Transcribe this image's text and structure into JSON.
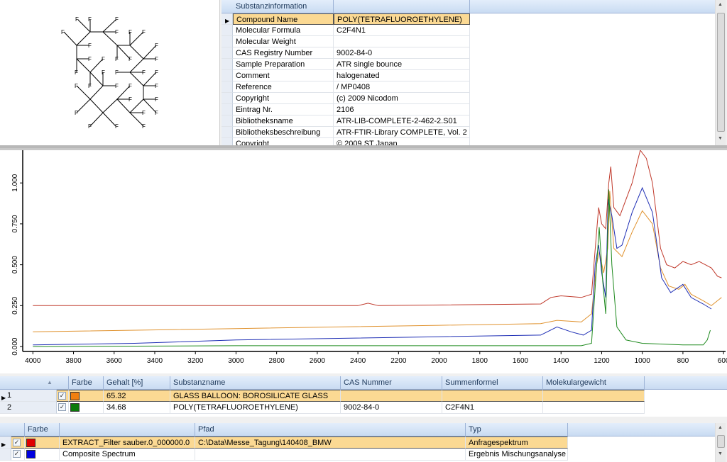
{
  "substance_info": {
    "header": "Substanzinformation",
    "rows": [
      {
        "label": "Compound Name",
        "value": "POLY(TETRAFLUOROETHYLENE)"
      },
      {
        "label": "Molecular Formula",
        "value": "C2F4N1"
      },
      {
        "label": "Molecular Weight",
        "value": ""
      },
      {
        "label": "CAS Registry Number",
        "value": "9002-84-0"
      },
      {
        "label": "Sample Preparation",
        "value": "ATR single bounce"
      },
      {
        "label": "Comment",
        "value": "halogenated"
      },
      {
        "label": "Reference",
        "value": "/ MP0408"
      },
      {
        "label": "Copyright",
        "value": "(c) 2009 Nicodom"
      },
      {
        "label": "Eintrag Nr.",
        "value": "2106"
      },
      {
        "label": "Bibliotheksname",
        "value": "ATR-LIB-COMPLETE-2-462-2.S01"
      },
      {
        "label": "Bibliotheksbeschreibung",
        "value": "ATR-FTIR-Library COMPLETE, Vol. 2"
      },
      {
        "label": "Copyright",
        "value": "© 2009 ST Japan"
      }
    ]
  },
  "molecule": {
    "atom_label": "F"
  },
  "chart_data": {
    "type": "line",
    "xlim": [
      4050,
      590
    ],
    "ylim": [
      -0.03,
      1.2
    ],
    "x_ticks": [
      "4000",
      "3800",
      "3600",
      "3400",
      "3200",
      "3000",
      "2800",
      "2600",
      "2400",
      "2200",
      "2000",
      "1800",
      "1600",
      "1400",
      "1200",
      "1000",
      "800",
      "600"
    ],
    "y_ticks": [
      "0.000",
      "0.250",
      "0.500",
      "0.750",
      "1.000"
    ],
    "grid": false,
    "series": [
      {
        "color": "#c0392b",
        "points": [
          [
            4000,
            0.25
          ],
          [
            3000,
            0.25
          ],
          [
            2400,
            0.25
          ],
          [
            2350,
            0.265
          ],
          [
            2300,
            0.25
          ],
          [
            1500,
            0.26
          ],
          [
            1450,
            0.3
          ],
          [
            1400,
            0.31
          ],
          [
            1300,
            0.3
          ],
          [
            1250,
            0.32
          ],
          [
            1225,
            0.7
          ],
          [
            1215,
            0.85
          ],
          [
            1200,
            0.75
          ],
          [
            1180,
            0.72
          ],
          [
            1165,
            1.0
          ],
          [
            1155,
            1.1
          ],
          [
            1140,
            0.85
          ],
          [
            1110,
            0.8
          ],
          [
            1050,
            1.0
          ],
          [
            1010,
            1.2
          ],
          [
            980,
            1.15
          ],
          [
            950,
            1.0
          ],
          [
            910,
            0.6
          ],
          [
            880,
            0.5
          ],
          [
            840,
            0.48
          ],
          [
            800,
            0.52
          ],
          [
            760,
            0.5
          ],
          [
            720,
            0.52
          ],
          [
            690,
            0.5
          ],
          [
            660,
            0.48
          ],
          [
            630,
            0.43
          ],
          [
            610,
            0.42
          ]
        ]
      },
      {
        "color": "#e0922e",
        "points": [
          [
            4000,
            0.09
          ],
          [
            3000,
            0.11
          ],
          [
            2000,
            0.13
          ],
          [
            1500,
            0.14
          ],
          [
            1420,
            0.16
          ],
          [
            1300,
            0.15
          ],
          [
            1250,
            0.2
          ],
          [
            1225,
            0.5
          ],
          [
            1212,
            0.58
          ],
          [
            1190,
            0.45
          ],
          [
            1170,
            0.6
          ],
          [
            1160,
            0.95
          ],
          [
            1140,
            0.6
          ],
          [
            1100,
            0.55
          ],
          [
            1050,
            0.7
          ],
          [
            1000,
            0.83
          ],
          [
            950,
            0.75
          ],
          [
            910,
            0.48
          ],
          [
            870,
            0.37
          ],
          [
            820,
            0.35
          ],
          [
            790,
            0.38
          ],
          [
            760,
            0.32
          ],
          [
            700,
            0.28
          ],
          [
            660,
            0.25
          ],
          [
            620,
            0.29
          ],
          [
            610,
            0.3
          ]
        ]
      },
      {
        "color": "#1f2fb5",
        "points": [
          [
            4000,
            0.01
          ],
          [
            3500,
            0.02
          ],
          [
            3000,
            0.04
          ],
          [
            2000,
            0.06
          ],
          [
            1500,
            0.07
          ],
          [
            1420,
            0.12
          ],
          [
            1350,
            0.09
          ],
          [
            1290,
            0.07
          ],
          [
            1250,
            0.1
          ],
          [
            1232,
            0.5
          ],
          [
            1215,
            0.62
          ],
          [
            1200,
            0.45
          ],
          [
            1180,
            0.3
          ],
          [
            1168,
            0.9
          ],
          [
            1150,
            0.8
          ],
          [
            1125,
            0.6
          ],
          [
            1100,
            0.62
          ],
          [
            1050,
            0.82
          ],
          [
            1000,
            0.97
          ],
          [
            950,
            0.82
          ],
          [
            905,
            0.42
          ],
          [
            860,
            0.33
          ],
          [
            800,
            0.38
          ],
          [
            760,
            0.3
          ],
          [
            700,
            0.26
          ],
          [
            660,
            0.23
          ]
        ]
      },
      {
        "color": "#1e8a1e",
        "points": [
          [
            4000,
            0.0
          ],
          [
            3000,
            0.005
          ],
          [
            2000,
            0.005
          ],
          [
            1300,
            0.005
          ],
          [
            1250,
            0.02
          ],
          [
            1230,
            0.4
          ],
          [
            1212,
            0.73
          ],
          [
            1195,
            0.4
          ],
          [
            1180,
            0.2
          ],
          [
            1165,
            0.96
          ],
          [
            1150,
            0.5
          ],
          [
            1125,
            0.12
          ],
          [
            1080,
            0.04
          ],
          [
            1000,
            0.02
          ],
          [
            800,
            0.01
          ],
          [
            700,
            0.01
          ],
          [
            680,
            0.04
          ],
          [
            665,
            0.1
          ]
        ]
      }
    ]
  },
  "components": {
    "columns": [
      "Farbe",
      "Gehalt [%]",
      "Substanzname",
      "CAS Nummer",
      "Summenformel",
      "Molekulargewicht"
    ],
    "rows": [
      {
        "index": "1",
        "checked": true,
        "color": "#f07f10",
        "gehalt": "65.32",
        "name": "GLASS BALLOON: BOROSILICATE GLASS",
        "cas": "",
        "formula": "",
        "mw": ""
      },
      {
        "index": "2",
        "checked": true,
        "color": "#0a7a0a",
        "gehalt": "34.68",
        "name": "POLY(TETRAFLUOROETHYLENE)",
        "cas": "9002-84-0",
        "formula": "C2F4N1",
        "mw": ""
      }
    ]
  },
  "spectra": {
    "columns": [
      "Farbe",
      "",
      "Pfad",
      "Typ"
    ],
    "rows": [
      {
        "checked": true,
        "color": "#e00000",
        "name": "EXTRACT_Filter sauber.0_000000.0",
        "path": "C:\\Data\\Messe_Tagung\\140408_BMW",
        "type": "Anfragespektrum"
      },
      {
        "checked": true,
        "color": "#0000e0",
        "name": "Composite Spectrum",
        "path": "",
        "type": "Ergebnis Mischungsanalyse"
      }
    ]
  }
}
